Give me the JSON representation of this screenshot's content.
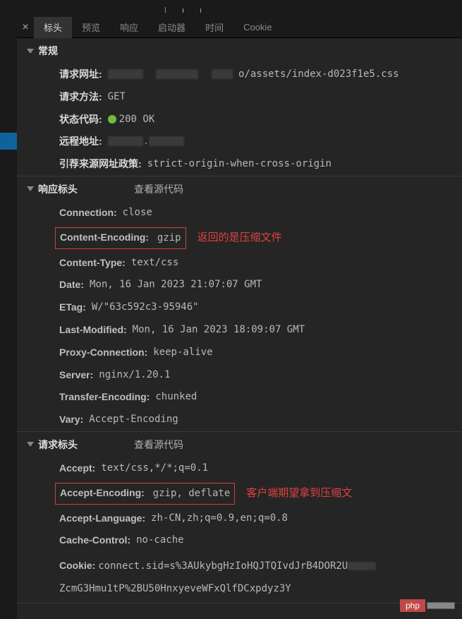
{
  "tabs": {
    "headers": "标头",
    "preview": "预览",
    "response": "响应",
    "initiator": "启动器",
    "timing": "时间",
    "cookie": "Cookie"
  },
  "sections": {
    "general": "常规",
    "response_headers": "响应标头",
    "request_headers": "请求标头",
    "view_source": "查看源代码"
  },
  "general": {
    "request_url_label": "请求网址:",
    "request_url_value": "o/assets/index-d023f1e5.css",
    "request_method_label": "请求方法:",
    "request_method_value": "GET",
    "status_code_label": "状态代码:",
    "status_code_value": "200 OK",
    "remote_address_label": "远程地址:",
    "referrer_policy_label": "引荐来源网址政策:",
    "referrer_policy_value": "strict-origin-when-cross-origin"
  },
  "response_headers": {
    "connection": {
      "k": "Connection:",
      "v": "close"
    },
    "content_encoding": {
      "k": "Content-Encoding:",
      "v": "gzip"
    },
    "content_type": {
      "k": "Content-Type:",
      "v": "text/css"
    },
    "date": {
      "k": "Date:",
      "v": "Mon, 16 Jan 2023 21:07:07 GMT"
    },
    "etag": {
      "k": "ETag:",
      "v": "W/\"63c592c3-95946\""
    },
    "last_modified": {
      "k": "Last-Modified:",
      "v": "Mon, 16 Jan 2023 18:09:07 GMT"
    },
    "proxy_connection": {
      "k": "Proxy-Connection:",
      "v": "keep-alive"
    },
    "server": {
      "k": "Server:",
      "v": "nginx/1.20.1"
    },
    "transfer_encoding": {
      "k": "Transfer-Encoding:",
      "v": "chunked"
    },
    "vary": {
      "k": "Vary:",
      "v": "Accept-Encoding"
    }
  },
  "request_headers": {
    "accept": {
      "k": "Accept:",
      "v": "text/css,*/*;q=0.1"
    },
    "accept_encoding": {
      "k": "Accept-Encoding:",
      "v": "gzip, deflate"
    },
    "accept_language": {
      "k": "Accept-Language:",
      "v": "zh-CN,zh;q=0.9,en;q=0.8"
    },
    "cache_control": {
      "k": "Cache-Control:",
      "v": "no-cache"
    },
    "cookie": {
      "k": "Cookie:",
      "v": "connect.sid=s%3AUkybgHzIoHQJTQIvdJrB4DOR2U",
      "v2": "ZcmG3Hmu1tP%2BU50HnxyeveWFxQlfDCxpdyz3Y"
    }
  },
  "annotations": {
    "response_gzip": "返回的是压缩文件",
    "request_gzip": "客户端期望拿到压缩文"
  },
  "logo": "php"
}
